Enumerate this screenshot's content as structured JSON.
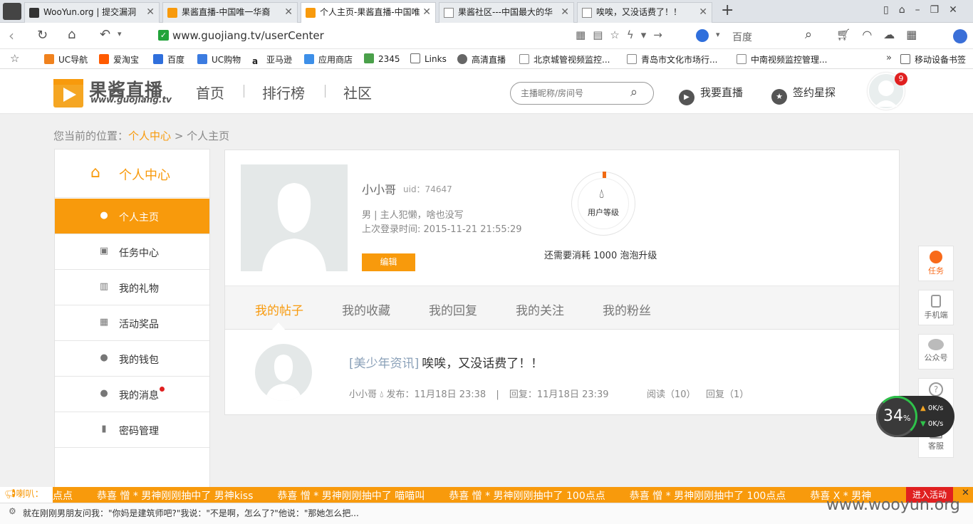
{
  "tabs": [
    {
      "title": "WooYun.org | 提交漏洞"
    },
    {
      "title": "果酱直播-中国唯一华裔"
    },
    {
      "title": "个人主页-果酱直播-中国唯"
    },
    {
      "title": "果酱社区---中国最大的华"
    },
    {
      "title": "唉唉，又没话费了！！"
    }
  ],
  "address": {
    "url": "www.guojiang.tv/userCenter",
    "search_engine": "百度"
  },
  "bookmarks": [
    "UC导航",
    "爱淘宝",
    "百度",
    "UC购物",
    "亚马逊",
    "应用商店",
    "2345",
    "Links",
    "高清直播",
    "北京城管视频监控...",
    "青岛市文化市场行...",
    "中南视频监控管理..."
  ],
  "bookmarks_right": "移动设备书签",
  "site": {
    "logo_text": "果酱直播",
    "logo_sub": "www.guojiang.tv",
    "nav": [
      "首页",
      "排行榜",
      "社区"
    ],
    "search_placeholder": "主播昵称/房间号",
    "btn_live": "我要直播",
    "btn_sign": "签约星探",
    "notif_count": "9"
  },
  "breadcrumb": {
    "prefix": "您当前的位置：",
    "link": "个人中心",
    "sep": ">",
    "current": "个人主页"
  },
  "sidebar": {
    "title": "个人中心",
    "items": [
      {
        "label": "个人主页",
        "icon": "user-icon"
      },
      {
        "label": "任务中心",
        "icon": "clipboard-icon"
      },
      {
        "label": "我的礼物",
        "icon": "gift-box-icon"
      },
      {
        "label": "活动奖品",
        "icon": "prize-icon"
      },
      {
        "label": "我的钱包",
        "icon": "wallet-icon"
      },
      {
        "label": "我的消息",
        "icon": "message-icon"
      },
      {
        "label": "密码管理",
        "icon": "lock-icon"
      }
    ]
  },
  "profile": {
    "name": "小小哥",
    "uid": "uid：74647",
    "bio": "男 | 主人犯懒，啥也没写",
    "last_login": "上次登录时间: 2015-11-21 21:55:29",
    "edit_label": "编辑",
    "level_label": "用户等级",
    "upgrade_text": "还需要消耗 1000 泡泡升级"
  },
  "profile_tabs": [
    "我的帖子",
    "我的收藏",
    "我的回复",
    "我的关注",
    "我的粉丝"
  ],
  "post": {
    "category": "[美少年资讯]",
    "title": "唉唉，又没话费了！！",
    "author": "小小哥",
    "posted": "发布：11月18日 23:38",
    "divider": "|",
    "replied": "回复：11月18日 23:39",
    "reads": "阅读（10）",
    "replies": "回复（1）"
  },
  "floats": [
    "任务",
    "手机端",
    "公众号",
    "帮助",
    "客服"
  ],
  "speed": {
    "percent": "34",
    "unit": "%",
    "up": "0K/s",
    "down": "0K/s"
  },
  "ticker": {
    "label": "喇叭：",
    "items": [
      "点点",
      "恭喜 憎 * 男神刚刚抽中了 男神kiss",
      "恭喜 憎 * 男神刚刚抽中了 喵喵叫",
      "恭喜 憎 * 男神刚刚抽中了 100点点",
      "恭喜 憎 * 男神刚刚抽中了 100点点",
      "恭喜 X * 男神"
    ],
    "button": "进入活动"
  },
  "status": {
    "text": "就在刚刚男朋友问我：\"你妈是建筑师吧?\"我说：\"不是啊，怎么了?\"他说：\"那她怎么把...",
    "watermark": "www.wooyun.org"
  },
  "colors": {
    "accent": "#f89a0c",
    "red": "#e02020"
  }
}
